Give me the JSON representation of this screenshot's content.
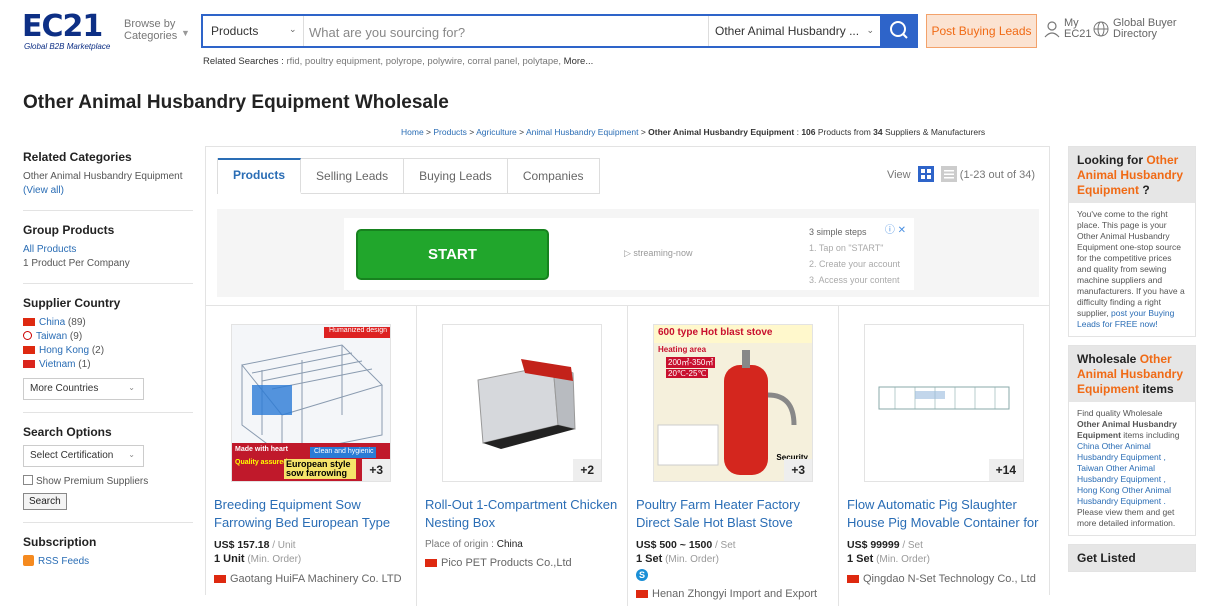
{
  "header": {
    "logo_text": "EC21",
    "logo_tagline": "Global B2B Marketplace",
    "browse_label_1": "Browse by",
    "browse_label_2": "Categories",
    "search": {
      "category": "Products",
      "placeholder": "What are you sourcing for?",
      "filter_category": "Other Animal Husbandry ..."
    },
    "post_button": "Post Buying Leads",
    "my_ec21_1": "My",
    "my_ec21_2": "EC21",
    "global_directory_1": "Global Buyer",
    "global_directory_2": "Directory"
  },
  "related": {
    "label": "Related Searches : ",
    "terms": "rfid, poultry equipment, polyrope, polywire, corral panel, polytape,",
    "more": "More..."
  },
  "page_title": "Other Animal Husbandry Equipment Wholesale",
  "breadcrumb": {
    "home": "Home",
    "products": "Products",
    "agriculture": "Agriculture",
    "animal_husbandry": "Animal Husbandry Equipment",
    "current": "Other Animal Husbandry Equipment",
    "count_text_1": " : ",
    "count_products": "106",
    "count_text_2": " Products from ",
    "count_suppliers": "34",
    "count_text_3": " Suppliers & Manufacturers"
  },
  "sidebar": {
    "related_title": "Related Categories",
    "related_text": "Other Animal Husbandry Equipment",
    "view_all": "(View all)",
    "group_title": "Group Products",
    "all_products": "All Products",
    "per_company": "1 Product Per Company",
    "country_title": "Supplier Country",
    "countries": [
      {
        "name": "China",
        "count": "(89)"
      },
      {
        "name": "Taiwan",
        "count": "(9)"
      },
      {
        "name": "Hong Kong",
        "count": "(2)"
      },
      {
        "name": "Vietnam",
        "count": "(1)"
      }
    ],
    "more_countries": "More Countries",
    "search_options_title": "Search Options",
    "select_cert": "Select Certification",
    "premium_label": "Show Premium Suppliers",
    "search_button": "Search",
    "subscription_title": "Subscription",
    "rss": "RSS Feeds"
  },
  "tabs": [
    "Products",
    "Selling Leads",
    "Buying Leads",
    "Companies"
  ],
  "view": {
    "label": "View",
    "range": "(1-23 out of 34)"
  },
  "ad": {
    "start": "START",
    "streaming": "streaming-now",
    "steps_title": "3 simple steps",
    "step1": "1. Tap on \"START\"",
    "step2": "2. Create your account",
    "step3": "3. Access your content"
  },
  "products": [
    {
      "title": "Breeding Equipment Sow Farrowing Bed European Type",
      "price": "US$ 157.18",
      "price_unit": " / Unit",
      "moq": "1 Unit",
      "moq_note": " (Min. Order)",
      "supplier": "Gaotang HuiFA Machinery Co. LTD",
      "badge": "+3",
      "img_top": "Humanized design",
      "img_bot1": "Made with heart",
      "img_bot2": "Clean and hygienic",
      "img_bot3": "Quality assured",
      "img_bot4": "European style sow farrowing"
    },
    {
      "title": "Roll-Out 1-Compartment Chicken Nesting Box",
      "origin_label": "Place of origin : ",
      "origin": "China",
      "supplier": "Pico PET Products Co.,Ltd",
      "badge": "+2"
    },
    {
      "title": "Poultry Farm Heater Factory Direct Sale Hot Blast Stove",
      "price": "US$ 500 ~ 1500",
      "price_unit": " / Set",
      "moq": "1 Set",
      "moq_note": " (Min. Order)",
      "supplier": "Henan Zhongyi Import and Export",
      "badge": "+3",
      "img_title": "600 type Hot blast stove",
      "img_heat": "Heating area",
      "img_area": "200㎡-350㎡",
      "img_temp": "20℃-25℃",
      "img_security": "Security"
    },
    {
      "title": "Flow Automatic Pig Slaughter House Pig Movable Container for",
      "price": "US$ 99999",
      "price_unit": " / Set",
      "moq": "1 Set",
      "moq_note": " (Min. Order)",
      "supplier": "Qingdao N-Set Technology Co., Ltd",
      "badge": "+14"
    }
  ],
  "right": {
    "box1_title_1": "Looking for ",
    "box1_title_2": "Other Animal Husbandry Equipment",
    "box1_title_3": " ?",
    "box1_text": "You've come to the right place. This page is your Other Animal Husbandry Equipment one-stop source for the competitive prices and quality from sewing machine suppliers and manufacturers. If you have a difficulty finding a right supplier, ",
    "box1_link": "post your Buying Leads for FREE now!",
    "box2_title_1": "Wholesale ",
    "box2_title_2": "Other Animal Husbandry Equipment",
    "box2_title_3": " items",
    "box2_text_1": "Find quality Wholesale ",
    "box2_text_bold": "Other Animal Husbandry Equipment",
    "box2_text_2": " items including ",
    "box2_links": "China Other Animal Husbandry Equipment , Taiwan Other Animal Husbandry Equipment , Hong Kong Other Animal Husbandry Equipment .",
    "box2_text_3": " Please view them and get more detailed information.",
    "box3_title": "Get Listed"
  },
  "colors": {
    "brand_blue": "#2e64c9",
    "link_blue": "#2a6db5",
    "accent_orange": "#f06a15",
    "start_green": "#21a62c"
  }
}
